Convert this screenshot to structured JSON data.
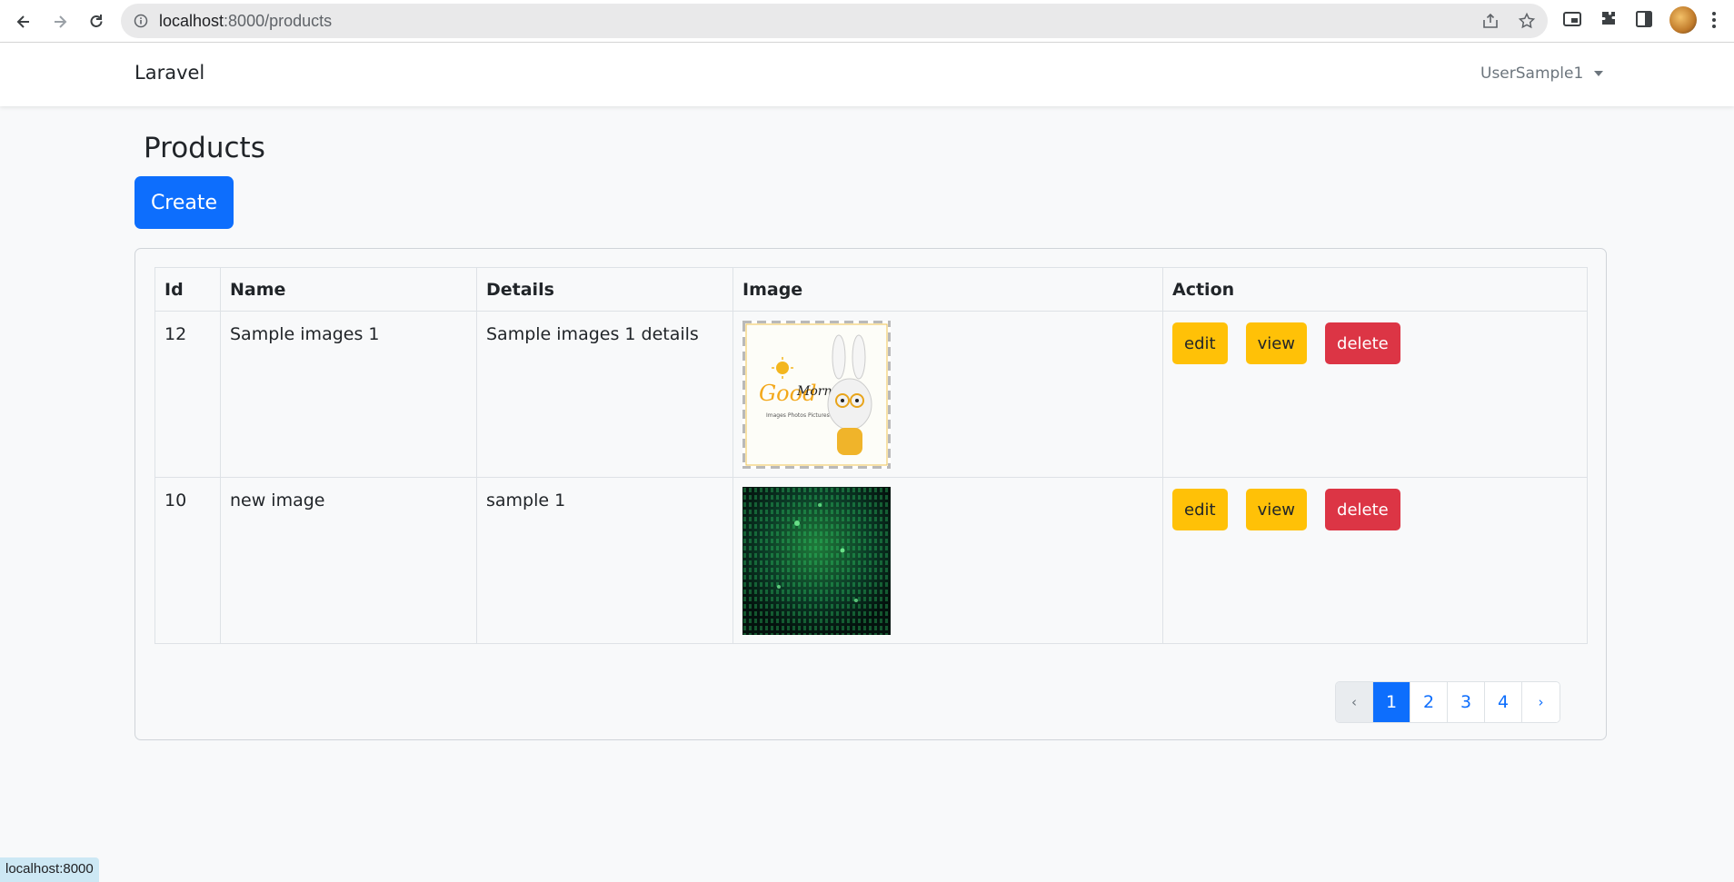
{
  "browser": {
    "url_host": "localhost",
    "url_path": ":8000/products"
  },
  "navbar": {
    "brand": "Laravel",
    "user_name": "UserSample1"
  },
  "page": {
    "title": "Products",
    "create_label": "Create"
  },
  "table": {
    "headers": [
      "Id",
      "Name",
      "Details",
      "Image",
      "Action"
    ],
    "rows": [
      {
        "id": "12",
        "name": "Sample images 1",
        "details": "Sample images 1 details",
        "image": "good-morning-bunny-image"
      },
      {
        "id": "10",
        "name": "new image",
        "details": "sample 1",
        "image": "green-matrix-image"
      }
    ],
    "actions": {
      "edit": "edit",
      "view": "view",
      "delete": "delete"
    }
  },
  "pagination": {
    "prev": "‹",
    "pages": [
      "1",
      "2",
      "3",
      "4"
    ],
    "active": "1",
    "next": "›"
  },
  "status_bar": {
    "text": "localhost:8000"
  },
  "colors": {
    "primary": "#0d6efd",
    "warning": "#ffc107",
    "danger": "#dc3545"
  }
}
